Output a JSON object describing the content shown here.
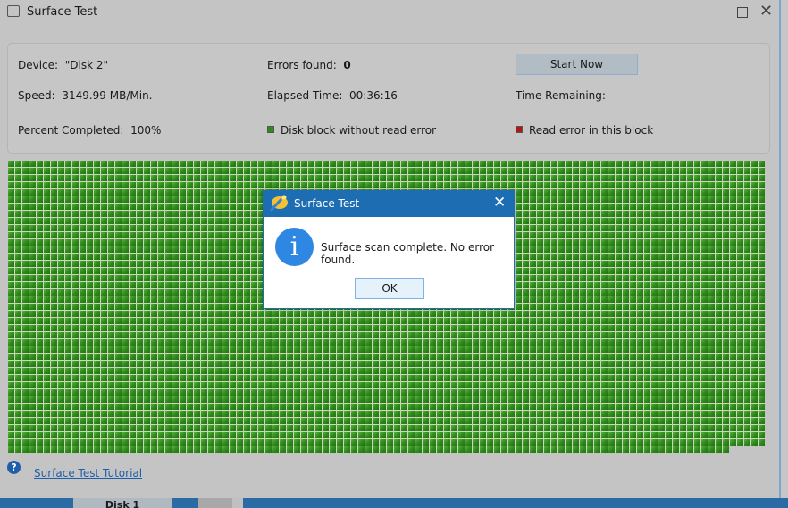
{
  "window": {
    "title": "Surface Test",
    "icon": "chart-line-icon"
  },
  "info": {
    "device_label": "Device:",
    "device_value": "\"Disk 2\"",
    "speed_label": "Speed:",
    "speed_value": "3149.99 MB/Min.",
    "percent_label": "Percent Completed:",
    "percent_value": "100%",
    "errors_label": "Errors found:",
    "errors_value": "0",
    "elapsed_label": "Elapsed Time:",
    "elapsed_value": "00:36:16",
    "remaining_label": "Time Remaining:",
    "start_button": "Start Now",
    "legend_ok": "Disk block without read error",
    "legend_err": "Read error in this block"
  },
  "colors": {
    "ok_block": "#2f8a1c",
    "error_block": "#b01818",
    "dialog_bar": "#1d6db3",
    "info_icon": "#2f87e4"
  },
  "dialog": {
    "title": "Surface Test",
    "message": "Surface scan complete. No error found.",
    "ok_button": "OK",
    "info_glyph": "i"
  },
  "footer": {
    "help_glyph": "?",
    "tutorial_link": "Surface Test Tutorial"
  },
  "taskbar": {
    "tab_label": "Disk 1"
  }
}
